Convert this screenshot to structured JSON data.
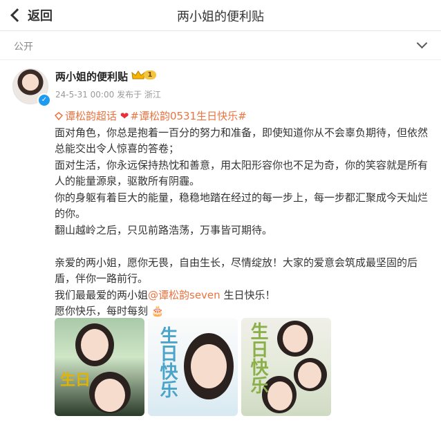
{
  "header": {
    "back_label": "返回",
    "title": "两小姐的便利贴"
  },
  "visibility": {
    "label": "公开"
  },
  "post": {
    "author": "两小姐的便利贴",
    "level": "1",
    "date": "24-5-31 00:00",
    "source": "发布于 浙江",
    "supertopic": "谭松韵超话",
    "hashtag": "#谭松韵0531生日快乐#",
    "lines": [
      "面对角色，你总是抱着一百分的努力和准备，即使知道你从不会辜负期待，但依然总能交出令人惊喜的答卷；",
      "面对生活，你永远保持热忱和善意，用太阳形容你也不足为奇，你的笑容就是所有人的能量源泉，驱散所有阴霾。",
      "你的身躯有着巨大的能量，稳稳地踏在经过的每一步上，每一步都汇聚成今天灿烂的你。",
      "翻山越岭之后，只见前路浩荡，万事皆可期待。"
    ],
    "lines2": [
      "亲爱的两小姐，愿你无畏，自由生长，尽情绽放！大家的爱意会筑成最坚固的后盾，伴你一路前行。"
    ],
    "mention_prefix": "我们最最爱的两小姐",
    "mention": "@谭松韵seven",
    "mention_suffix": " 生日快乐！",
    "last_line": "愿你快乐，每时每刻",
    "images": [
      {
        "name": "birthday-photo-1",
        "text": "生日"
      },
      {
        "name": "birthday-photo-2",
        "text": "生日快乐"
      },
      {
        "name": "birthday-photo-3",
        "text": "生日快乐"
      }
    ]
  },
  "colors": {
    "link": "#eb7340",
    "heart": "#e8303a",
    "verified": "#1d9bf0",
    "level_badge": "#f4c542"
  }
}
